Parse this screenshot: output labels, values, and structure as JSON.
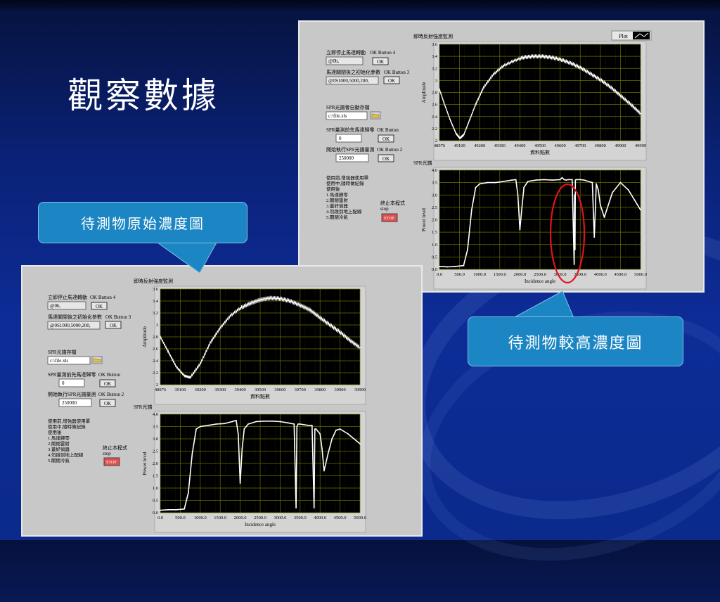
{
  "slide": {
    "title": "觀察數據",
    "callout_original": "待測物原始濃度圖",
    "callout_high": "待測物較高濃度圖"
  },
  "colors": {
    "plot_bg": "#000000",
    "grid": "#6b6b00",
    "trace": "#ffffff",
    "panel": "#c8c8c8",
    "callout": "#1b86c3",
    "highlight_ellipse": "#e0141e",
    "stop_button": "#e05050"
  },
  "panel_a": {
    "plot_toggle_label": "Plot",
    "controls": {
      "stop_motor_label": "立即停止馬達轉動",
      "stop_motor_button_label": "OK Button 4",
      "stop_motor_value": "@0b,",
      "ok": "OK",
      "init_params_label": "馬達關閉後之初始化參數",
      "init_params_button_label": "OK Button 3",
      "init_params_value": "@0S1000,5000,200,",
      "autosave_label": "SPR光譜會自動存檔",
      "file_path": "c:\\file.xls",
      "zero_label": "SPR量測前先馬達歸零",
      "zero_button_label": "OK Button",
      "zero_value": "0",
      "run_label": "開始執行SPR光譜量測",
      "run_button_label": "OK Button 2",
      "run_value": "250000",
      "instructions": [
        "使用前,增強器使用單",
        "使用中,隨時做紀錄",
        "使用後",
        "1.馬達歸零",
        "2.關閉雷射",
        "3.蓋好偵器",
        "4.勿踫到地上配線",
        "5.關閉冷氣"
      ],
      "terminate_label": "終止本程式",
      "terminate_sub": "stop",
      "stop_button": "STOP"
    },
    "chart1": {
      "title": "即時反射強度監測",
      "ylabel": "Amplitude",
      "xlabel": "資料點數",
      "x_ticks": [
        "48976",
        "49100",
        "49200",
        "49300",
        "49400",
        "49500",
        "49600",
        "49700",
        "49800",
        "49900",
        "49999"
      ],
      "y_ticks": [
        "2",
        "2.2",
        "2.4",
        "2.6",
        "2.8",
        "3",
        "3.2",
        "3.4",
        "3.6"
      ]
    },
    "chart2": {
      "title": "SPR光譜",
      "ylabel": "Power level",
      "xlabel": "Incidence angle",
      "x_ticks": [
        "0.0",
        "500.0",
        "1000.0",
        "1500.0",
        "2000.0",
        "2500.0",
        "3000.0",
        "3500.0",
        "4000.0",
        "4500.0",
        "5000.0"
      ],
      "y_ticks": [
        "0.0",
        "0.5",
        "1.0",
        "1.5",
        "2.0",
        "2.5",
        "3.0",
        "3.5",
        "4.0"
      ]
    }
  },
  "panel_b": {
    "controls": {
      "stop_motor_label": "立即停止馬達轉動",
      "stop_motor_button_label": "OK Button 4",
      "stop_motor_value": "@0b,",
      "ok": "OK",
      "init_params_label": "馬達關閉後之初始化參數",
      "init_params_button_label": "OK Button 3",
      "init_params_value": "@0S1000,5000,200,",
      "autosave_label": "SPR光譜存檔",
      "file_path": "c:\\file.xls",
      "zero_label": "SPR量測前先馬達歸零",
      "zero_button_label": "OK Button",
      "zero_value": "0",
      "run_label": "開始執行SPR光譜量測",
      "run_button_label": "OK Button 2",
      "run_value": "250000",
      "instructions": [
        "使用前,增強器使用單",
        "使用中,隨時做紀錄",
        "使用後",
        "1.馬達歸零",
        "2.關閉雷射",
        "3.蓋好偵器",
        "4.勿踫到地上配線",
        "5.關閉冷氣"
      ],
      "terminate_label": "終止本程式",
      "terminate_sub": "stop",
      "stop_button": "STOP"
    },
    "chart1": {
      "title": "即時反射強度監測",
      "ylabel": "Amplitude",
      "xlabel": "資料點數",
      "x_ticks": [
        "48976",
        "39100",
        "39200",
        "39300",
        "39400",
        "39500",
        "39600",
        "39700",
        "39800",
        "39900",
        "39999"
      ],
      "y_ticks": [
        "2",
        "2.2",
        "2.4",
        "2.6",
        "2.8",
        "3",
        "3.2",
        "3.4",
        "3.6"
      ]
    },
    "chart2": {
      "title": "SPR光譜",
      "ylabel": "Power level",
      "xlabel": "Incidence angle",
      "x_ticks": [
        "0.0",
        "500.0",
        "1000.0",
        "1500.0",
        "2000.0",
        "2500.0",
        "3000.0",
        "3500.0",
        "4000.0",
        "4500.0",
        "5000.0"
      ],
      "y_ticks": [
        "0.0",
        "0.5",
        "1.0",
        "1.5",
        "2.0",
        "2.5",
        "3.0",
        "3.5",
        "4.0"
      ]
    }
  },
  "chart_data": [
    {
      "type": "line",
      "panel": "panel_a",
      "title": "即時反射強度監測",
      "xlabel": "資料點數",
      "ylabel": "Amplitude",
      "xlim": [
        48976,
        49999
      ],
      "ylim": [
        2.0,
        3.6
      ],
      "grid": true,
      "x": [
        48976,
        49000,
        49030,
        49060,
        49080,
        49100,
        49130,
        49160,
        49200,
        49250,
        49300,
        49350,
        49400,
        49450,
        49500,
        49550,
        49600,
        49650,
        49700,
        49750,
        49800,
        49850,
        49900,
        49950,
        49999
      ],
      "y": [
        2.85,
        2.62,
        2.35,
        2.12,
        2.04,
        2.1,
        2.35,
        2.6,
        2.88,
        3.1,
        3.24,
        3.32,
        3.38,
        3.4,
        3.4,
        3.38,
        3.34,
        3.28,
        3.2,
        3.1,
        3.0,
        2.88,
        2.74,
        2.6,
        2.45
      ]
    },
    {
      "type": "line",
      "panel": "panel_a",
      "title": "SPR光譜",
      "xlabel": "Incidence angle",
      "ylabel": "Power level",
      "xlim": [
        0,
        5000
      ],
      "ylim": [
        0,
        4.0
      ],
      "grid": true,
      "x": [
        0,
        200,
        400,
        600,
        700,
        800,
        900,
        1000,
        1200,
        1400,
        1600,
        1800,
        1900,
        1950,
        2000,
        2050,
        2100,
        2200,
        2400,
        2600,
        2800,
        3000,
        3050,
        3100,
        3150,
        3200,
        3300,
        3350,
        3360,
        3370,
        3380,
        3400,
        3500,
        3600,
        3800,
        3850,
        3900,
        3950,
        4000,
        4100,
        4200,
        4300,
        4500,
        4700,
        4850,
        5000
      ],
      "y": [
        0.12,
        0.1,
        0.12,
        0.15,
        0.8,
        2.4,
        3.3,
        3.45,
        3.5,
        3.5,
        3.55,
        3.6,
        3.62,
        3.0,
        1.6,
        2.5,
        3.3,
        3.55,
        3.6,
        3.62,
        3.6,
        3.62,
        3.7,
        3.62,
        3.6,
        3.62,
        3.62,
        0.2,
        3.0,
        0.8,
        3.6,
        3.62,
        3.62,
        3.6,
        3.5,
        1.3,
        3.45,
        3.2,
        2.6,
        2.1,
        2.6,
        3.1,
        3.5,
        3.2,
        2.8,
        2.4
      ]
    },
    {
      "type": "line",
      "panel": "panel_b",
      "title": "即時反射強度監測",
      "xlabel": "資料點數",
      "ylabel": "Amplitude",
      "ylim": [
        2.0,
        3.6
      ],
      "grid": true,
      "x": [
        0,
        0.04,
        0.08,
        0.12,
        0.15,
        0.2,
        0.25,
        0.3,
        0.35,
        0.4,
        0.45,
        0.5,
        0.55,
        0.6,
        0.65,
        0.7,
        0.75,
        0.8,
        0.85,
        0.9,
        0.95,
        1.0
      ],
      "y": [
        2.8,
        2.55,
        2.3,
        2.15,
        2.12,
        2.35,
        2.7,
        2.95,
        3.15,
        3.28,
        3.36,
        3.42,
        3.45,
        3.44,
        3.4,
        3.33,
        3.25,
        3.12,
        3.0,
        2.88,
        2.74,
        2.62
      ]
    },
    {
      "type": "line",
      "panel": "panel_b",
      "title": "SPR光譜",
      "xlabel": "Incidence angle",
      "ylabel": "Power level",
      "xlim": [
        0,
        5000
      ],
      "ylim": [
        0,
        4.0
      ],
      "grid": true,
      "x": [
        0,
        200,
        400,
        600,
        700,
        800,
        900,
        1000,
        1200,
        1400,
        1600,
        1800,
        1900,
        1950,
        2000,
        2050,
        2100,
        2200,
        2400,
        2600,
        2800,
        3000,
        3200,
        3350,
        3400,
        3420,
        3450,
        3500,
        3700,
        3800,
        3850,
        3870,
        3900,
        4000,
        4050,
        4100,
        4200,
        4300,
        4400,
        4500,
        4700,
        5000
      ],
      "y": [
        0.1,
        0.12,
        0.12,
        0.15,
        0.8,
        2.4,
        3.4,
        3.5,
        3.55,
        3.6,
        3.62,
        3.7,
        3.75,
        3.2,
        1.2,
        2.6,
        3.4,
        3.6,
        3.7,
        3.72,
        3.72,
        3.7,
        3.65,
        3.6,
        0.2,
        3.5,
        3.6,
        3.6,
        3.55,
        3.55,
        0.2,
        3.4,
        3.4,
        3.2,
        2.6,
        1.7,
        2.4,
        3.0,
        3.35,
        3.4,
        3.2,
        2.8
      ]
    }
  ]
}
